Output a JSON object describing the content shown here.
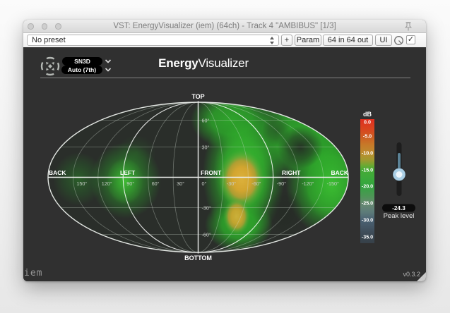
{
  "window": {
    "title": "VST: EnergyVisualizer (iem) (64ch) - Track 4 \"AMBIBUS\" [1/3]"
  },
  "toolbar": {
    "preset": "No preset",
    "add_label": "+",
    "param_label": "Param",
    "io_label": "64 in 64 out",
    "ui_label": "UI"
  },
  "icons": {
    "checkmark": "✓"
  },
  "plugin": {
    "normalization": "SN3D",
    "order": "Auto (7th)",
    "title_bold": "Energy",
    "title_rest": "Visualizer",
    "brand": "iem",
    "version": "v0.3.2",
    "peak": {
      "value": "-24.3",
      "label": "Peak level"
    },
    "colorbar": {
      "unit": "dB",
      "ticks": [
        "0.0",
        "-5.0",
        "-10.0",
        "-15.0",
        "-20.0",
        "-25.0",
        "-30.0",
        "-35.0"
      ]
    },
    "map": {
      "top": "TOP",
      "bottom": "BOTTOM",
      "directions": [
        "BACK",
        "LEFT",
        "FRONT",
        "RIGHT",
        "BACK"
      ],
      "meridian_labels": [
        "150°",
        "120°",
        "90°",
        "60°",
        "30°",
        "0°",
        "-30°",
        "-60°",
        "-90°",
        "-120°",
        "-150°"
      ],
      "parallel_labels": [
        "60°",
        "30°",
        "-30°",
        "-60°"
      ]
    }
  }
}
